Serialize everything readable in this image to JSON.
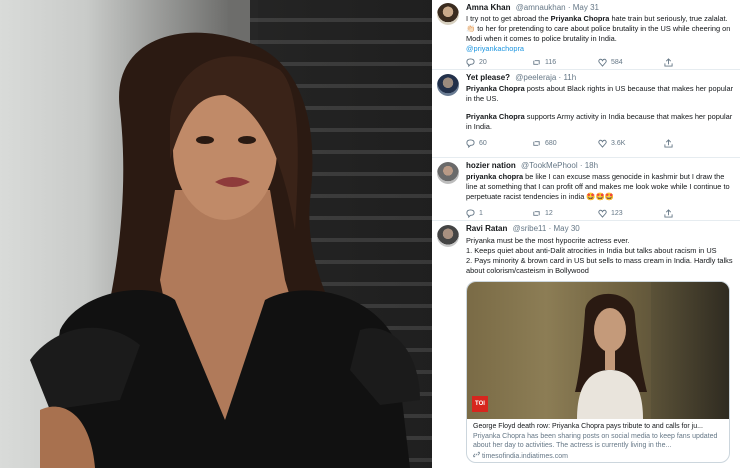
{
  "tweets": [
    {
      "name": "Amna Khan",
      "handle": "@amnaukhan",
      "time": "May 31",
      "text_a": "I try not to get abroad the ",
      "mention": "Priyanka Chopra",
      "text_b": " hate train but seriously, true zalalat. ",
      "text_c": " to her for pretending to care about police brutality in the US while cheering on Modi when it comes to police brutality in India.",
      "emoji": "👏🏻",
      "hashtag": "@priyankachopra",
      "replies": "20",
      "retweets": "116",
      "likes": "584"
    },
    {
      "name": "Yet please?",
      "handle": "@peeleraja",
      "time": "11h",
      "line1_name": "Priyanka Chopra",
      "line1_text": " posts about Black rights in US because that makes her popular in the US.",
      "line2_name": "Priyanka Chopra",
      "line2_text": " supports Army activity in India because that makes her popular in India.",
      "replies": "60",
      "retweets": "680",
      "likes": "3.6K"
    },
    {
      "name": "hozier nation",
      "handle": "@TookMePhool",
      "time": "18h",
      "name_lower": "priyanka chopra",
      "text": " be like I can excuse mass genocide in kashmir but I draw the line at something that I can profit off and makes me look woke while I continue to perpetuate racist tendencies in india ",
      "emoji": "🤩🤩🤩",
      "replies": "1",
      "retweets": "12",
      "likes": "123"
    },
    {
      "name": "Ravi Ratan",
      "handle": "@sribe11",
      "time": "May 30",
      "line1": "Priyanka must be the most hypocrite actress ever.",
      "line2": "1. Keeps quiet about anti-Dalit atrocities in India but talks about racism in US",
      "line3": "2. Pays minority & brown card in US but sells to mass cream in India. Hardly talks about colorism/casteism in Bollywood",
      "card": {
        "badge": "TOI",
        "title": "George Floyd death row: Priyanka Chopra pays tribute to and calls for ju...",
        "desc": "Priyanka Chopra has been sharing posts on social media to keep fans updated about her day to activities. The actress is currently living in the...",
        "url": "timesofindia.indiatimes.com"
      }
    }
  ],
  "icons": {
    "reply": "reply-icon",
    "retweet": "retweet-icon",
    "like": "heart-icon",
    "share": "share-icon"
  },
  "colors": {
    "link": "#1b95e0",
    "text": "#14171a",
    "muted": "#657786",
    "toi": "#d7261e"
  }
}
